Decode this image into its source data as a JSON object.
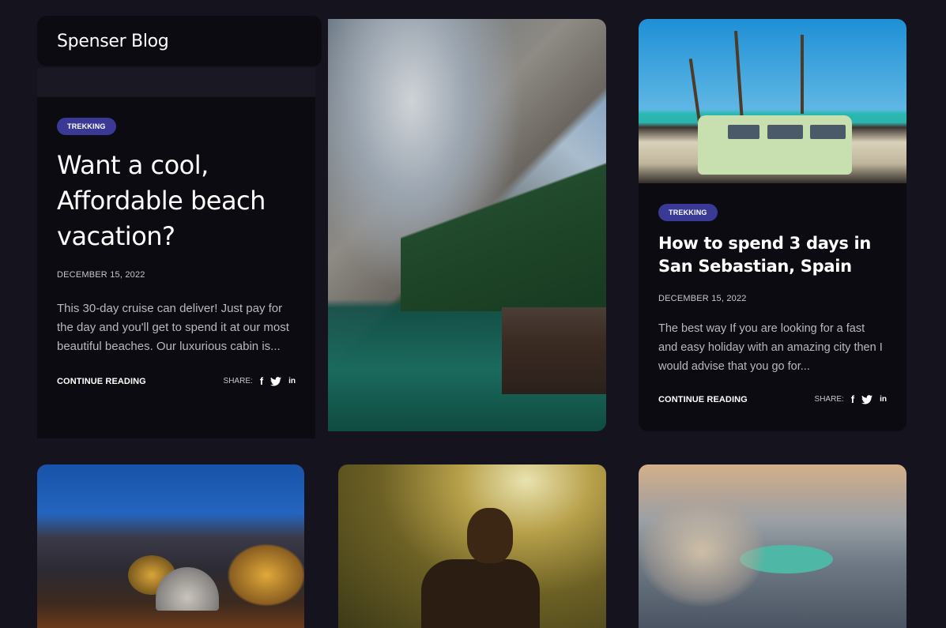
{
  "site": {
    "title": "Spenser Blog"
  },
  "posts": [
    {
      "tag": "TREKKING",
      "title": "Want a cool, Affordable beach vacation?",
      "date": "DECEMBER 15, 2022",
      "excerpt": "This 30-day cruise can deliver! Just pay for the day and you'll get to spend it at our most beautiful beaches. Our luxurious cabin is...",
      "continue_label": "CONTINUE READING",
      "share_label": "SHARE:"
    },
    {
      "tag": "TREKKING",
      "title": "How to spend 3 days in San Sebastian, Spain",
      "date": "DECEMBER 15, 2022",
      "excerpt": "The best way If you are looking for a fast and easy holiday with an amazing city then I would advise that you go for...",
      "continue_label": "CONTINUE READING",
      "share_label": "SHARE:"
    }
  ],
  "social": {
    "facebook": "f",
    "linkedin": "in"
  },
  "colors": {
    "background": "#15131d",
    "card": "#0c0b12",
    "tag": "#3b3996"
  }
}
